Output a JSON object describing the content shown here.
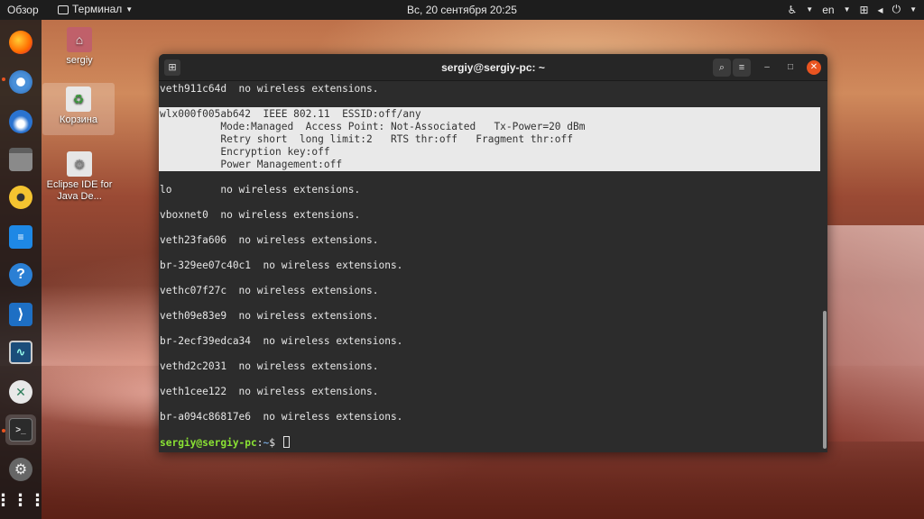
{
  "topbar": {
    "overview": "Обзор",
    "app_name": "Терминал",
    "clock": "Вс, 20 сентября  20:25",
    "lang": "en"
  },
  "dock": {
    "items": [
      "firefox-icon",
      "chromium-icon",
      "thunderbird-icon",
      "files-icon",
      "rhythmbox-icon",
      "writer-icon",
      "help-icon",
      "vscode-icon",
      "system-monitor-icon",
      "remmina-icon",
      "terminal-icon",
      "settings-icon",
      "show-apps-icon"
    ]
  },
  "desktop": {
    "icons": [
      {
        "label": "sergiy"
      },
      {
        "label": "Корзина"
      },
      {
        "label": "Eclipse IDE for Java De..."
      }
    ]
  },
  "terminal": {
    "title": "sergiy@sergiy-pc: ~",
    "lines": [
      "veth911c64d  no wireless extensions.",
      "lo        no wireless extensions.",
      "vboxnet0  no wireless extensions.",
      "veth23fa606  no wireless extensions.",
      "br-329ee07c40c1  no wireless extensions.",
      "vethc07f27c  no wireless extensions.",
      "veth09e83e9  no wireless extensions.",
      "br-2ecf39edca34  no wireless extensions.",
      "vethd2c2031  no wireless extensions.",
      "veth1cee122  no wireless extensions.",
      "br-a094c86817e6  no wireless extensions."
    ],
    "highlight": [
      "wlx000f005ab642  IEEE 802.11  ESSID:off/any",
      "          Mode:Managed  Access Point: Not-Associated   Tx-Power=20 dBm",
      "          Retry short  long limit:2   RTS thr:off   Fragment thr:off",
      "          Encryption key:off",
      "          Power Management:off"
    ],
    "prompt": {
      "user": "sergiy@sergiy-pc",
      "sep": ":",
      "path": "~",
      "symbol": "$"
    }
  },
  "colors": {
    "accent": "#e95420",
    "terminal_bg": "#2c2c2c",
    "prompt_user": "#8ae234",
    "prompt_path": "#729fcf",
    "highlight_bg": "#e9e9e9"
  }
}
